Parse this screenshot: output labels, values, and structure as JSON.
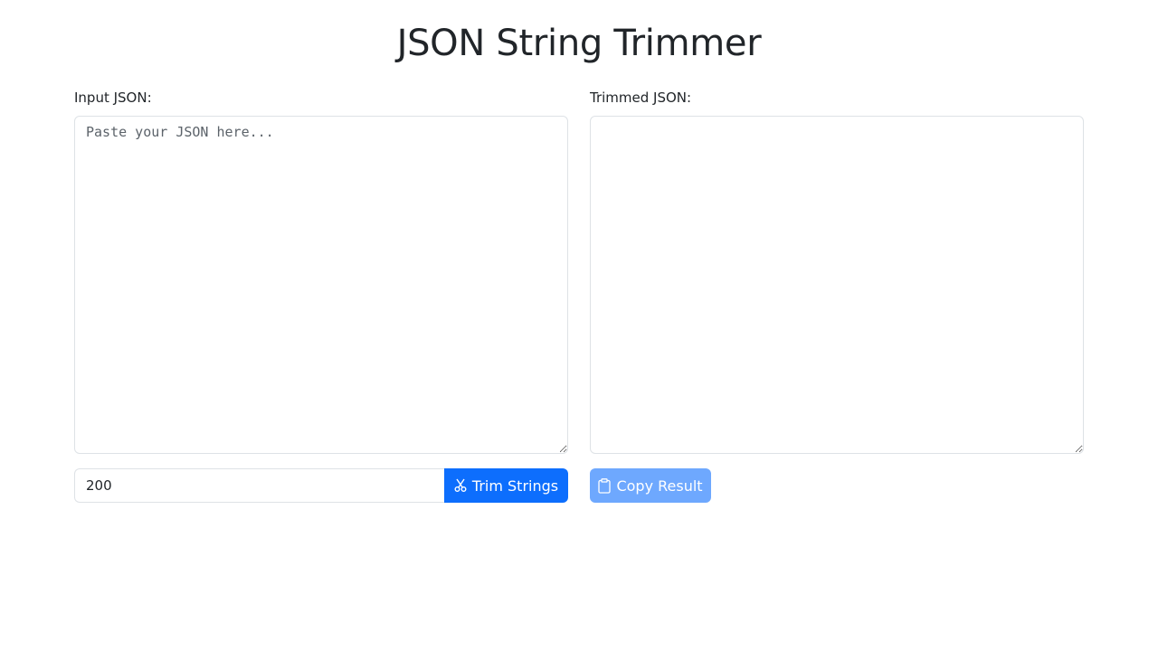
{
  "header": {
    "title": "JSON String Trimmer"
  },
  "input_panel": {
    "label": "Input JSON:",
    "placeholder": "Paste your JSON here...",
    "value": ""
  },
  "output_panel": {
    "label": "Trimmed JSON:",
    "value": ""
  },
  "controls": {
    "max_length_value": "200",
    "trim_button_label": "Trim Strings",
    "trim_button_icon": "scissors-icon",
    "copy_button_label": "Copy Result",
    "copy_button_icon": "clipboard-icon",
    "copy_button_disabled": true
  },
  "colors": {
    "primary": "#0d6efd",
    "primary_disabled": "#6ea8fe",
    "border": "#dee2e6",
    "text": "#212529"
  }
}
